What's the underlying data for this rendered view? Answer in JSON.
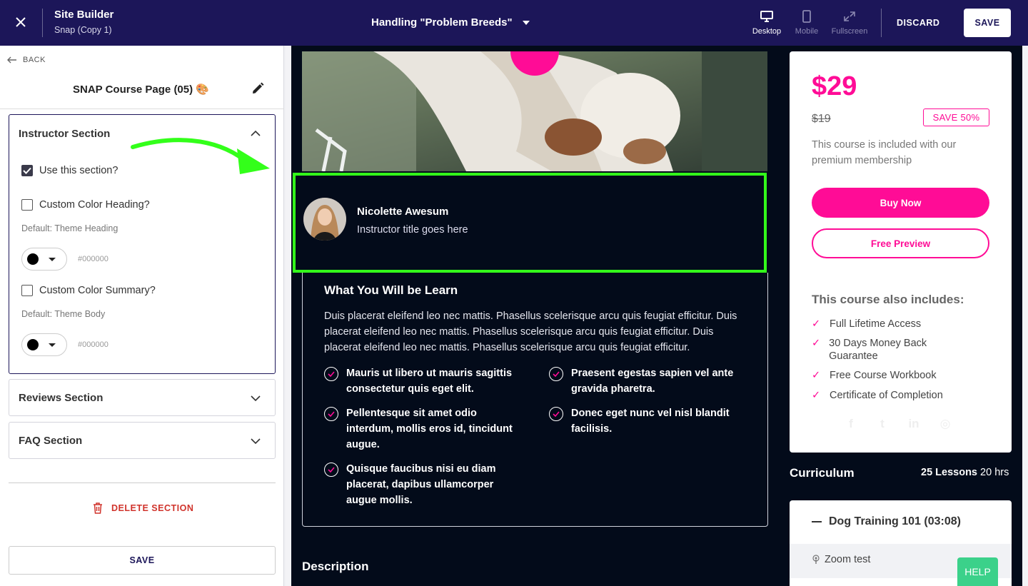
{
  "topbar": {
    "app_title": "Site Builder",
    "app_subtitle": "Snap (Copy 1)",
    "page_selector": "Handling \"Problem Breeds\"",
    "view_desktop": "Desktop",
    "view_mobile": "Mobile",
    "view_fullscreen": "Fullscreen",
    "discard": "DISCARD",
    "save": "SAVE",
    "bg_color": "#1c1659"
  },
  "left_panel": {
    "back": "BACK",
    "page_name": "SNAP Course Page (05) 🎨",
    "instructor_section": {
      "title": "Instructor Section",
      "use_section_label": "Use this section?",
      "use_section_checked": true,
      "custom_heading_label": "Custom Color Heading?",
      "custom_heading_checked": false,
      "heading_default": "Default: Theme Heading",
      "heading_hex": "#000000",
      "custom_summary_label": "Custom Color Summary?",
      "custom_summary_checked": false,
      "summary_default": "Default: Theme Body",
      "summary_hex": "#000000"
    },
    "reviews_section": "Reviews Section",
    "faq_section": "FAQ Section",
    "delete_section": "DELETE SECTION",
    "save": "SAVE"
  },
  "preview": {
    "instructor": {
      "name": "Nicolette Awesum",
      "title": "Instructor title goes here"
    },
    "learn": {
      "title": "What You Will be Learn",
      "paragraph": "Duis placerat eleifend leo nec mattis. Phasellus scelerisque arcu quis feugiat efficitur. Duis placerat eleifend leo nec mattis. Phasellus scelerisque arcu quis feugiat efficitur. Duis placerat eleifend leo nec mattis. Phasellus scelerisque arcu quis feugiat efficitur.",
      "items": [
        "Mauris ut libero ut mauris sagittis consectetur quis eget elit.",
        "Praesent egestas sapien vel ante gravida pharetra.",
        "Pellentesque sit amet odio interdum, mollis eros id, tincidunt augue.",
        "Donec eget nunc vel nisl blandit facilisis.",
        "Quisque faucibus nisi eu diam placerat, dapibus ullamcorper augue mollis."
      ]
    },
    "description_title": "Description",
    "pricing": {
      "price": "$29",
      "old_price": "$19",
      "badge": "SAVE 50%",
      "included": "This course is included with our premium membership",
      "buy": "Buy Now",
      "free_preview": "Free Preview",
      "also_title": "This course also includes:",
      "includes": [
        "Full Lifetime Access",
        "30 Days Money Back Guarantee",
        "Free Course Workbook",
        "Certificate of Completion"
      ],
      "accent_color": "#ff0c96"
    },
    "curriculum": {
      "title": "Curriculum",
      "lessons": "25 Lessons",
      "hours": "20 hrs",
      "module": "Dog Training 101 (03:08)",
      "lesson": "Zoom test"
    },
    "help": "HELP",
    "highlight_color": "#33ff1a"
  }
}
